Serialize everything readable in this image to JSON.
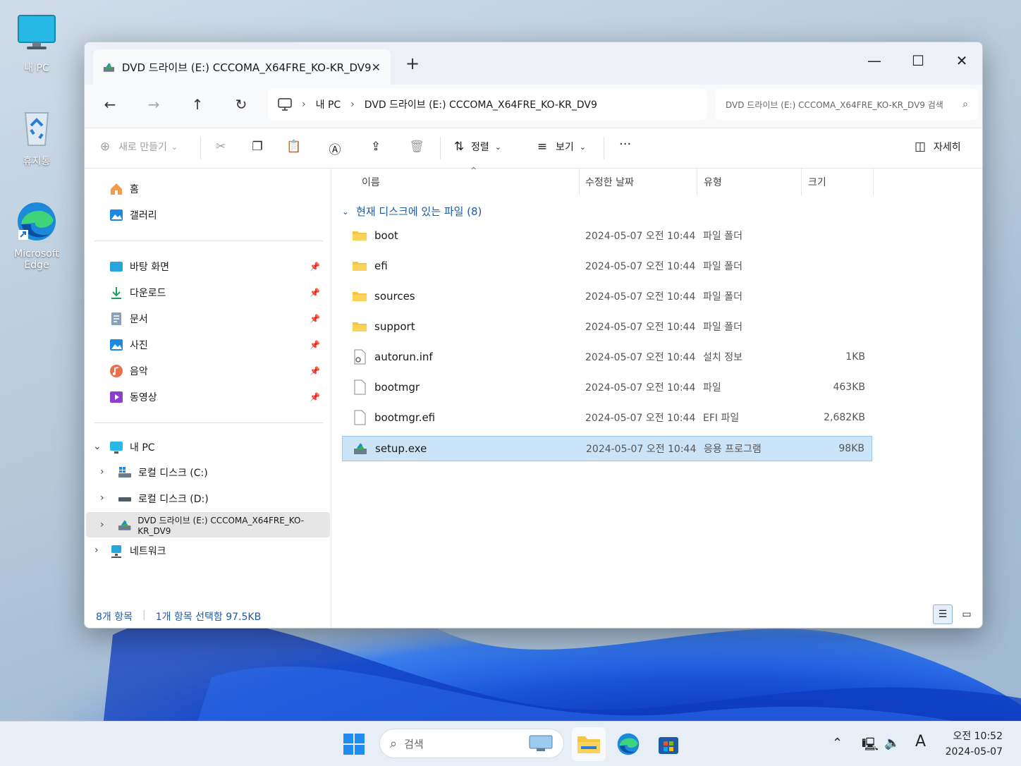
{
  "desktop": {
    "icons": [
      {
        "label": "내 PC"
      },
      {
        "label": "휴지통"
      },
      {
        "label": "Microsoft Edge"
      }
    ]
  },
  "window": {
    "tab_title": "DVD 드라이브 (E:) CCCOMA_X64FRE_KO-KR_DV9",
    "new_tab": "+",
    "controls": {
      "minimize": "—",
      "maximize": "☐",
      "close": "✕"
    }
  },
  "address": {
    "crumbs": [
      "내 PC",
      "DVD 드라이브 (E:) CCCOMA_X64FRE_KO-KR_DV9"
    ],
    "search_placeholder": "DVD 드라이브 (E:) CCCOMA_X64FRE_KO-KR_DV9 검색"
  },
  "commandbar": {
    "new_label": "새로 만들기",
    "sort_label": "정렬",
    "view_label": "보기",
    "more_label": "···",
    "details_label": "자세히"
  },
  "sidebar": {
    "quick": [
      {
        "label": "홈"
      },
      {
        "label": "갤러리"
      }
    ],
    "pinned": [
      {
        "label": "바탕 화면"
      },
      {
        "label": "다운로드"
      },
      {
        "label": "문서"
      },
      {
        "label": "사진"
      },
      {
        "label": "음악"
      },
      {
        "label": "동영상"
      }
    ],
    "tree": [
      {
        "label": "내 PC"
      },
      {
        "label": "로컬 디스크 (C:)"
      },
      {
        "label": "로컬 디스크 (D:)"
      },
      {
        "label": "DVD 드라이브 (E:) CCCOMA_X64FRE_KO-KR_DV9"
      },
      {
        "label": "네트워크"
      }
    ]
  },
  "columns": {
    "name": "이름",
    "date": "수정한 날짜",
    "type": "유형",
    "size": "크기"
  },
  "group_header": "현재 디스크에 있는 파일 (8)",
  "files": [
    {
      "name": "boot",
      "date": "2024-05-07 오전 10:44",
      "type": "파일 폴더",
      "size": ""
    },
    {
      "name": "efi",
      "date": "2024-05-07 오전 10:44",
      "type": "파일 폴더",
      "size": ""
    },
    {
      "name": "sources",
      "date": "2024-05-07 오전 10:44",
      "type": "파일 폴더",
      "size": ""
    },
    {
      "name": "support",
      "date": "2024-05-07 오전 10:44",
      "type": "파일 폴더",
      "size": ""
    },
    {
      "name": "autorun.inf",
      "date": "2024-05-07 오전 10:44",
      "type": "설치 정보",
      "size": "1KB"
    },
    {
      "name": "bootmgr",
      "date": "2024-05-07 오전 10:44",
      "type": "파일",
      "size": "463KB"
    },
    {
      "name": "bootmgr.efi",
      "date": "2024-05-07 오전 10:44",
      "type": "EFI 파일",
      "size": "2,682KB"
    },
    {
      "name": "setup.exe",
      "date": "2024-05-07 오전 10:44",
      "type": "응용 프로그램",
      "size": "98KB"
    }
  ],
  "status": {
    "count": "8개 항목",
    "selection": "1개 항목 선택함 97.5KB"
  },
  "taskbar": {
    "search_placeholder": "검색",
    "ime": "A",
    "time": "오전 10:52",
    "date": "2024-05-07"
  },
  "colors": {
    "accent": "#1f5aa6",
    "selection_bg": "#cce4f7",
    "folder": "#f4c542"
  }
}
